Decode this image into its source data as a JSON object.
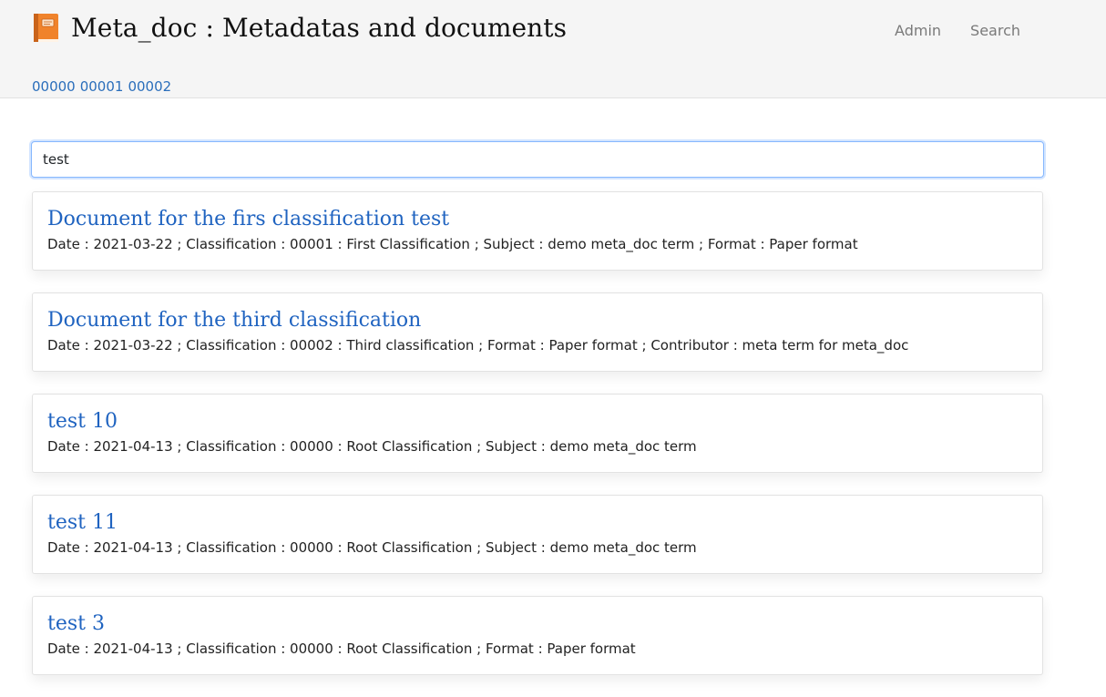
{
  "header": {
    "title": "Meta_doc : Metadatas and documents",
    "logo_icon": "book-icon",
    "nav": [
      {
        "label": "Admin"
      },
      {
        "label": "Search"
      }
    ],
    "breadcrumbs": [
      {
        "label": "00000"
      },
      {
        "label": "00001"
      },
      {
        "label": "00002"
      }
    ]
  },
  "search": {
    "value": "test"
  },
  "results": [
    {
      "title": "Document for the firs classification test",
      "meta": "Date : 2021-03-22 ; Classification : 00001 : First Classification ; Subject : demo meta_doc term ; Format : Paper format"
    },
    {
      "title": "Document for the third classification",
      "meta": "Date : 2021-03-22 ; Classification : 00002 : Third classification ; Format : Paper format ; Contributor : meta term for meta_doc"
    },
    {
      "title": "test 10",
      "meta": "Date : 2021-04-13 ; Classification : 00000 : Root Classification ; Subject : demo meta_doc term"
    },
    {
      "title": "test 11",
      "meta": "Date : 2021-04-13 ; Classification : 00000 : Root Classification ; Subject : demo meta_doc term"
    },
    {
      "title": "test 3",
      "meta": "Date : 2021-04-13 ; Classification : 00000 : Root Classification ; Format : Paper format"
    }
  ],
  "colors": {
    "link": "#1f63c0",
    "header_bg": "#f5f5f5",
    "book_orange": "#f0832b"
  }
}
